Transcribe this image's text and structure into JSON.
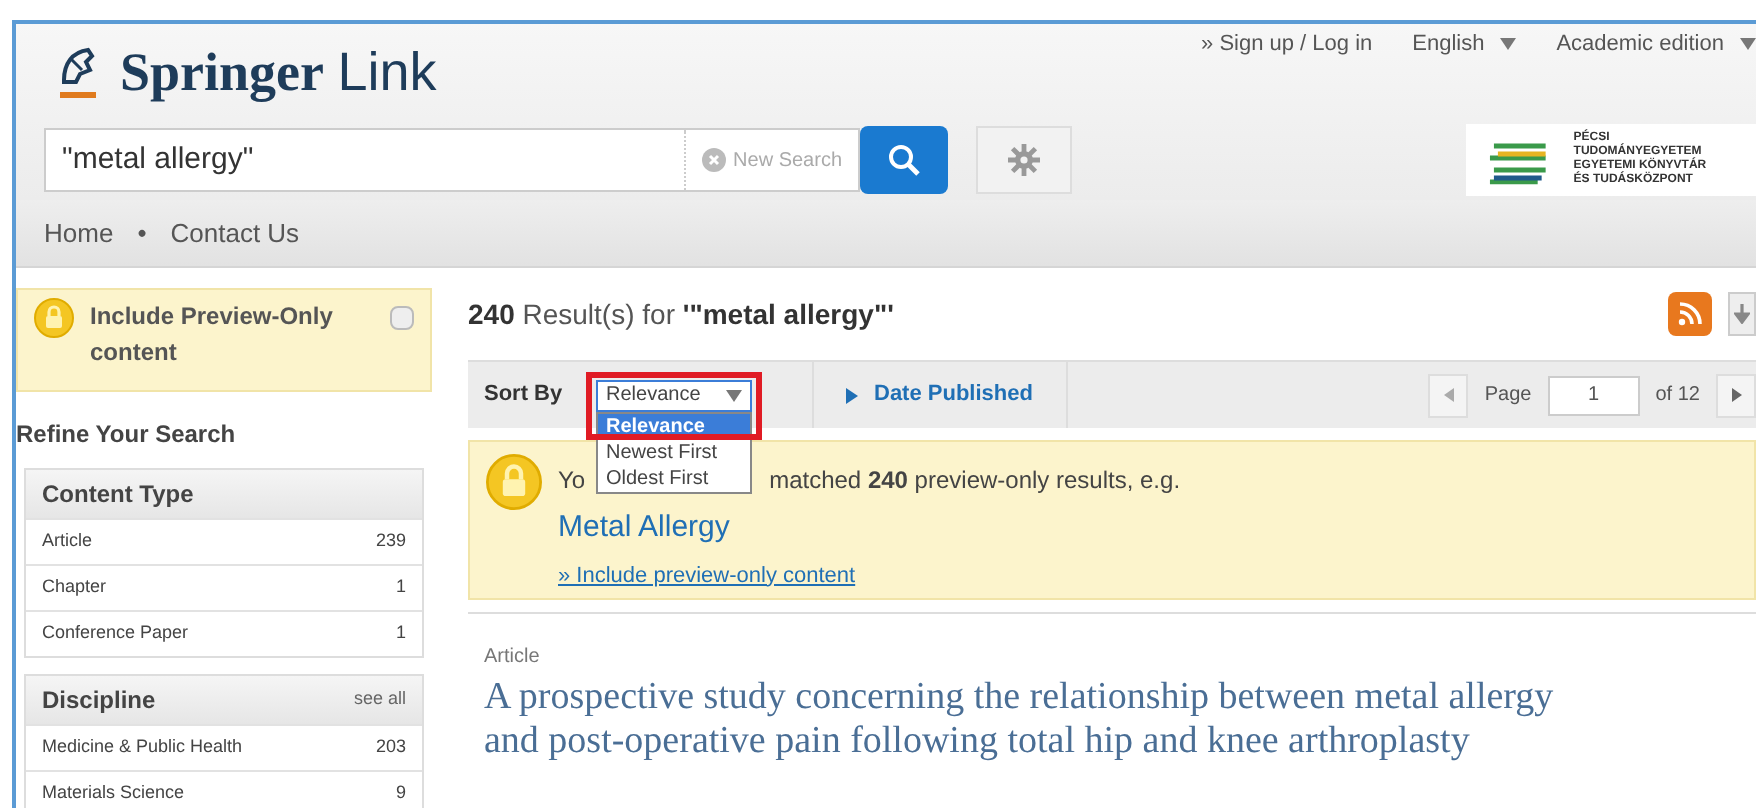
{
  "header": {
    "brand_bold": "Springer",
    "brand_light": "Link",
    "top_links": [
      {
        "label": "» Sign up / Log in",
        "dropdown": false
      },
      {
        "label": "English",
        "dropdown": true
      },
      {
        "label": "Academic edition",
        "dropdown": true
      }
    ],
    "search": {
      "value": "\"metal allergy\"",
      "clear_label": "New Search"
    },
    "library_logo": [
      "PÉCSI TUDOMÁNYEGYETEM",
      "EGYETEMI KÖNYVTÁR",
      "ÉS TUDÁSKÖZPONT"
    ]
  },
  "breadcrumb": [
    {
      "label": "Home"
    },
    {
      "label": "•"
    },
    {
      "label": "Contact Us"
    }
  ],
  "sidebar": {
    "preview_toggle": {
      "label": "Include **Preview-Only** content",
      "checked": false
    },
    "refine_title": "Refine Your Search",
    "facets": [
      {
        "title": "Content Type",
        "items": [
          {
            "label": "Article",
            "count": "239"
          },
          {
            "label": "Chapter",
            "count": "1"
          },
          {
            "label": "Conference Paper",
            "count": "1"
          }
        ]
      },
      {
        "title": "Discipline",
        "see_all": "see all",
        "items": [
          {
            "label": "Medicine & Public Health",
            "count": "203"
          },
          {
            "label": "Materials Science",
            "count": "9"
          }
        ]
      }
    ]
  },
  "results": {
    "count": "240",
    "heading": "Result(s) for",
    "query": "'\"metal allergy\"'",
    "sort": {
      "label": "Sort By",
      "value": "Relevance",
      "expanded": true,
      "options": [
        {
          "label": "Relevance",
          "selected": true
        },
        {
          "label": "Newest First",
          "selected": false
        },
        {
          "label": "Oldest First",
          "selected": false
        }
      ]
    },
    "date_filter": "Date Published",
    "pager": {
      "label": "Page",
      "value": "1",
      "of": "of 12"
    },
    "notice": {
      "lead": "Yo",
      "text": "matched **240** preview-only results, e.g.",
      "example": "Metal Allergy",
      "link": "» Include preview-only content"
    },
    "items": [
      {
        "type": "Article",
        "title": "A prospective study concerning the relationship between metal allergy and post-operative pain following total hip and knee arthroplasty"
      }
    ]
  }
}
